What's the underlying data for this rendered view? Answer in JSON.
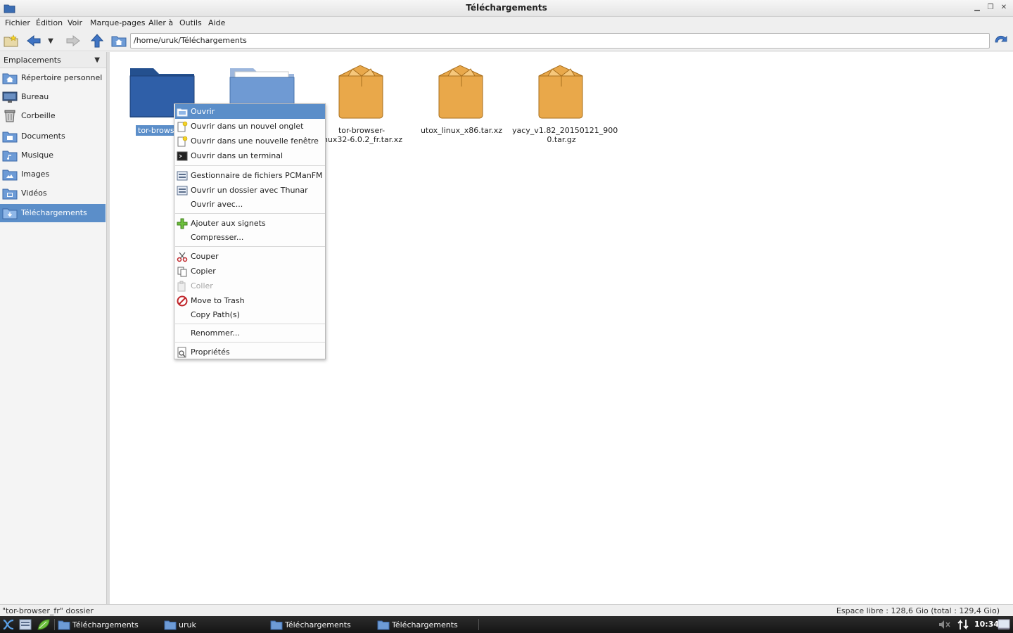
{
  "window": {
    "title": "Téléchargements"
  },
  "menubar": [
    "Fichier",
    "Édition",
    "Voir",
    "Marque-pages",
    "Aller à",
    "Outils",
    "Aide"
  ],
  "toolbar": {
    "path": "/home/uruk/Téléchargements"
  },
  "sidebar": {
    "header": "Emplacements",
    "items": [
      {
        "label": "Répertoire personnel",
        "icon": "home-folder-icon"
      },
      {
        "label": "Bureau",
        "icon": "desktop-icon"
      },
      {
        "label": "Corbeille",
        "icon": "trash-icon"
      },
      {
        "label": "Documents",
        "icon": "documents-folder-icon"
      },
      {
        "label": "Musique",
        "icon": "music-folder-icon"
      },
      {
        "label": "Images",
        "icon": "images-folder-icon"
      },
      {
        "label": "Vidéos",
        "icon": "videos-folder-icon"
      },
      {
        "label": "Téléchargements",
        "icon": "downloads-folder-icon",
        "selected": true
      }
    ]
  },
  "files": [
    {
      "name": "tor-browse",
      "icon": "folder-icon",
      "selected": true
    },
    {
      "name": "",
      "icon": "folder-icon"
    },
    {
      "name": "tor-browser-linux32-6.0.2_fr.tar.xz",
      "name_display": "tor-browser-\ninux32-6.0.2_fr.tar.xz",
      "icon": "archive-icon"
    },
    {
      "name": "utox_linux_x86.tar.xz",
      "icon": "archive-icon"
    },
    {
      "name": "yacy_v1.82_20150121_9000.tar.gz",
      "name_display": "yacy_v1.82_20150121_900\n0.tar.gz",
      "icon": "archive-icon"
    }
  ],
  "context_menu": {
    "items": [
      {
        "label": "Ouvrir",
        "highlight": true
      },
      {
        "label": "Ouvrir dans un nouvel onglet"
      },
      {
        "label": "Ouvrir dans une nouvelle fenêtre"
      },
      {
        "label": "Ouvrir dans un terminal"
      },
      {
        "label": "Gestionnaire de fichiers PCManFM"
      },
      {
        "label": "Ouvrir un dossier avec Thunar"
      },
      {
        "label": "Ouvrir avec..."
      },
      {
        "label": "Ajouter aux signets"
      },
      {
        "label": "Compresser..."
      },
      {
        "label": "Couper"
      },
      {
        "label": "Copier"
      },
      {
        "label": "Coller",
        "disabled": true
      },
      {
        "label": "Move to Trash"
      },
      {
        "label": "Copy Path(s)"
      },
      {
        "label": "Renommer..."
      },
      {
        "label": "Propriétés"
      }
    ]
  },
  "statusbar": {
    "left": "\"tor-browser_fr\" dossier",
    "right": "Espace libre : 128,6 Gio (total : 129,4 Gio)"
  },
  "taskbar": {
    "tasks": [
      "Téléchargements",
      "uruk",
      "Téléchargements",
      "Téléchargements"
    ],
    "clock": "10:34"
  },
  "colors": {
    "selection": "#5b8ec9",
    "folder": "#2f5fa8",
    "archive": "#e9a84a"
  }
}
